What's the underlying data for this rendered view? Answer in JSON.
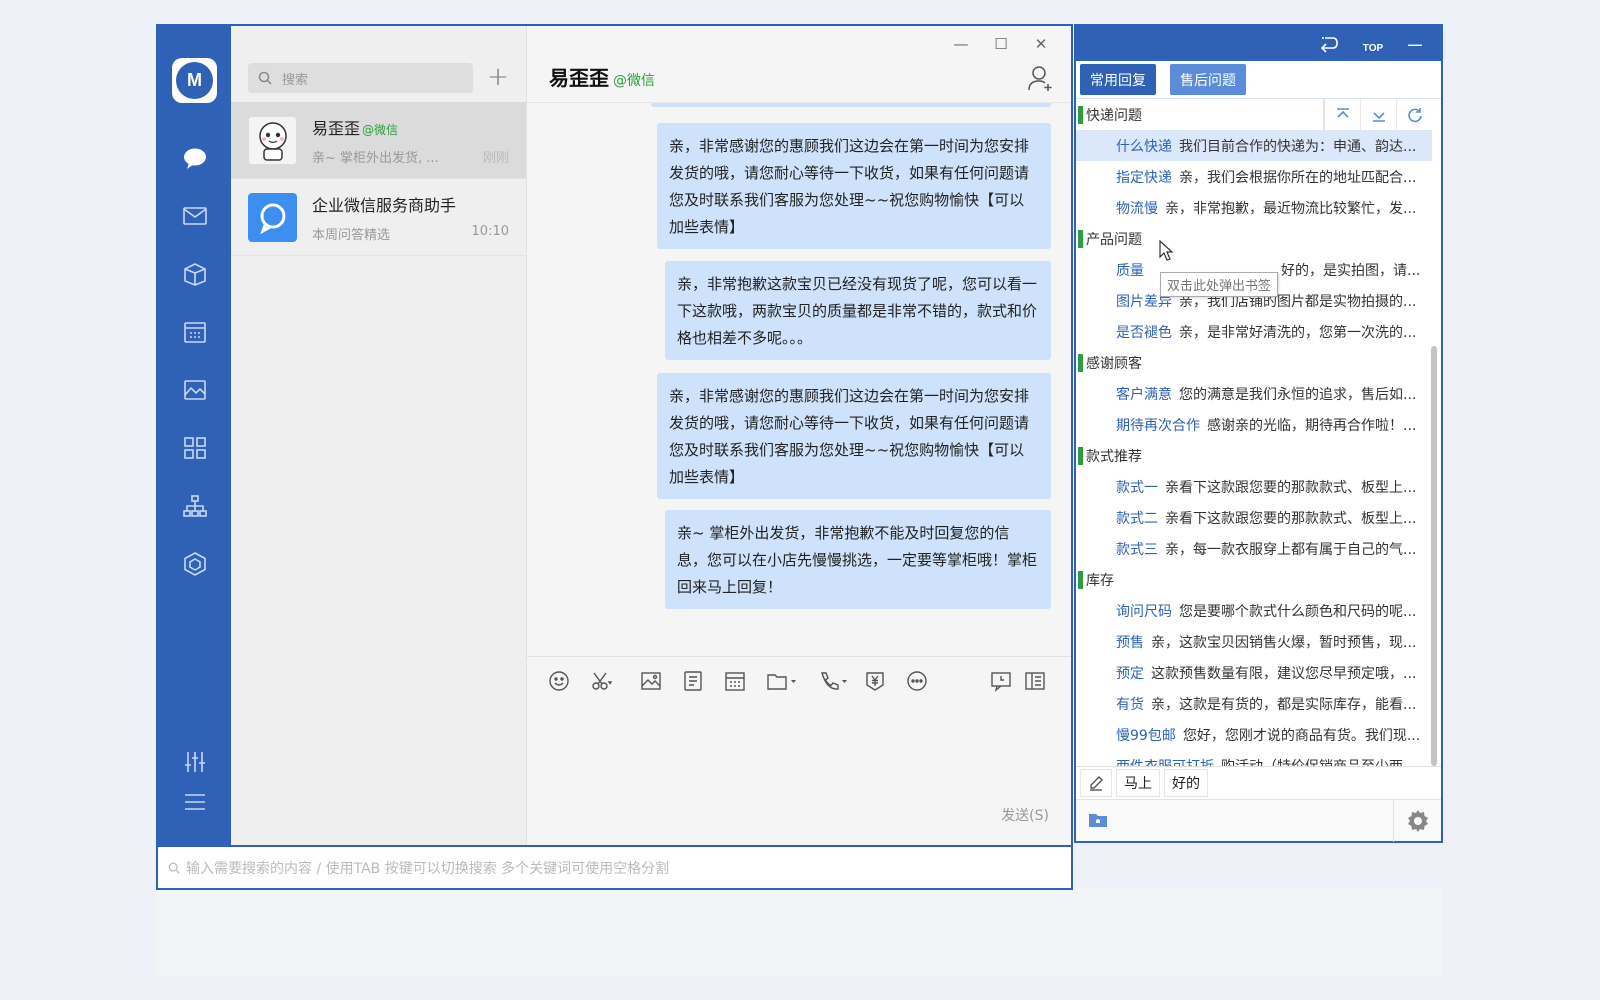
{
  "window": {
    "brand_initials": "M",
    "controls": [
      "—",
      "☐",
      "✕"
    ]
  },
  "sidebar": {
    "icons": [
      "chat-icon",
      "mail-icon",
      "box-icon",
      "calendar-icon",
      "image-icon",
      "apps-icon",
      "org-chart-icon",
      "hexagon-icon",
      "settings-sliders-icon",
      "menu-icon"
    ]
  },
  "contacts": {
    "search_placeholder": "搜索",
    "add_label": "+",
    "items": [
      {
        "name": "易歪歪",
        "tag": "@微信",
        "preview": "亲~ 掌柜外出发货, ...",
        "time": "刚刚"
      },
      {
        "name": "企业微信服务商助手",
        "tag": "",
        "preview": "本周问答精选",
        "time": "10:10"
      }
    ]
  },
  "chat": {
    "title": "易歪歪",
    "title_tag": "@微信",
    "messages": [
      {
        "text": "亲，非常感谢您的惠顾我们这边会在第一时间为您安排发货的哦，请您耐心等待一下收货，如果有任何问题请您及时联系我们客服为您处理~~祝您购物愉快【可以加些表情】"
      },
      {
        "text": "亲，非常抱歉这款宝贝已经没有现货了呢，您可以看一下这款哦，两款宝贝的质量都是非常不错的，款式和价格也相差不多呢。。。"
      },
      {
        "text": "亲，非常感谢您的惠顾我们这边会在第一时间为您安排发货的哦，请您耐心等待一下收货，如果有任何问题请您及时联系我们客服为您处理~~祝您购物愉快【可以加些表情】"
      },
      {
        "text": "亲~ 掌柜外出发货，非常抱歉不能及时回复您的信息，您可以在小店先慢慢挑选，一定要等掌柜哦！掌柜回来马上回复！"
      }
    ],
    "send_label": "发送(S)"
  },
  "bottom_search": {
    "placeholder": "输入需要搜索的内容 / 使用TAB 按键可以切换搜索 多个关键词可使用空格分割"
  },
  "panel": {
    "top_buttons": [
      "undo-icon",
      "TOP",
      "—"
    ],
    "tabs": [
      "常用回复",
      "售后问题"
    ],
    "active_tab": 1,
    "tooltip": "双击此处弹出书签",
    "categories": [
      {
        "name": "快递问题",
        "items": [
          {
            "key": "什么快递",
            "text": "我们目前合作的快递为：申通、韵达..."
          },
          {
            "key": "指定快递",
            "text": "亲，我们会根据你所在的地址匹配合..."
          },
          {
            "key": "物流慢",
            "text": "亲，非常抱歉，最近物流比较繁忙，发..."
          }
        ]
      },
      {
        "name": "产品问题",
        "items": [
          {
            "key": "质量",
            "text": "好的，是实拍图，请..."
          },
          {
            "key": "图片差异",
            "text": "亲，我们店铺的图片都是实物拍摄的..."
          },
          {
            "key": "是否褪色",
            "text": "亲，是非常好清洗的，您第一次洗的..."
          }
        ]
      },
      {
        "name": "感谢顾客",
        "items": [
          {
            "key": "客户满意",
            "text": "您的满意是我们永恒的追求，售后如..."
          },
          {
            "key": "期待再次合作",
            "text": "感谢亲的光临，期待再合作啦！..."
          }
        ]
      },
      {
        "name": "款式推荐",
        "items": [
          {
            "key": "款式一",
            "text": "亲看下这款跟您要的那款款式、板型上..."
          },
          {
            "key": "款式二",
            "text": "亲看下这款跟您要的那款款式、板型上..."
          },
          {
            "key": "款式三",
            "text": "亲，每一款衣服穿上都有属于自己的气..."
          }
        ]
      },
      {
        "name": "库存",
        "items": [
          {
            "key": "询问尺码",
            "text": "您是要哪个款式什么颜色和尺码的呢..."
          },
          {
            "key": "预售",
            "text": "亲，这款宝贝因销售火爆，暂时预售，现..."
          },
          {
            "key": "预定",
            "text": "这款预售数量有限，建议您尽早预定哦，..."
          },
          {
            "key": "有货",
            "text": "亲，这款是有货的，都是实际库存，能看..."
          },
          {
            "key": "慢99包邮",
            "text": "您好，您刚才说的商品有货。我们现..."
          },
          {
            "key": "两件衣服可打折",
            "text": "购活动（特价促销商品至少两..."
          }
        ]
      }
    ],
    "quick": [
      "马上",
      "好的"
    ]
  },
  "colors": {
    "brand": "#2f62b6",
    "bubble": "#cfe2fb",
    "tag_green": "#2c9e3e"
  }
}
